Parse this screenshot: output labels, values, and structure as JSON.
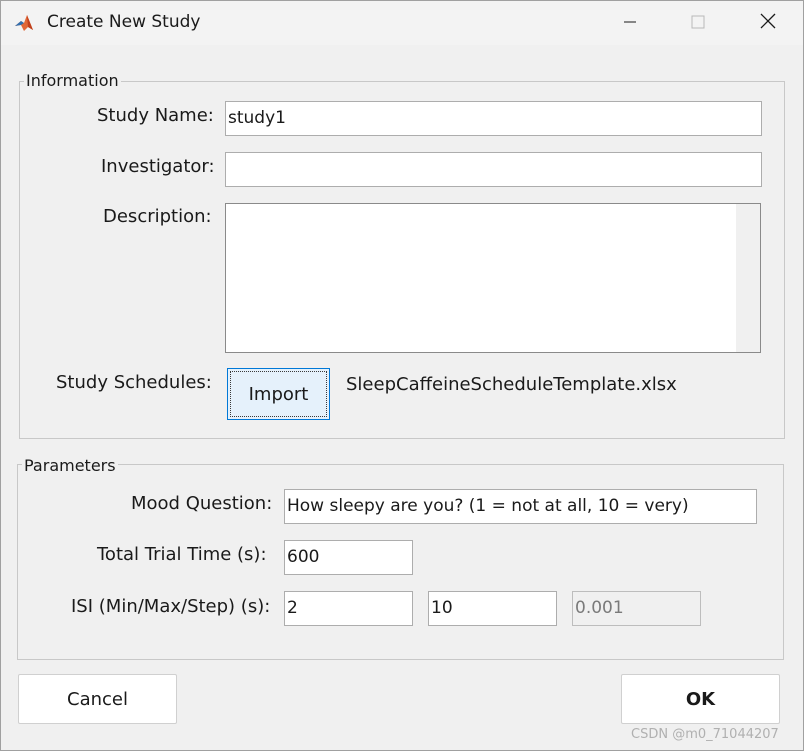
{
  "window": {
    "title": "Create New Study"
  },
  "information": {
    "legend": "Information",
    "study_name_label": "Study Name:",
    "study_name_value": "study1",
    "investigator_label": "Investigator:",
    "investigator_value": "",
    "description_label": "Description:",
    "description_value": "",
    "schedules_label": "Study Schedules:",
    "import_label": "Import",
    "schedule_file": "SleepCaffeineScheduleTemplate.xlsx"
  },
  "parameters": {
    "legend": "Parameters",
    "mood_label": "Mood Question:",
    "mood_value": "How sleepy are you? (1 = not at all, 10 = very)",
    "trial_label": "Total Trial Time (s):",
    "trial_value": "600",
    "isi_label": "ISI (Min/Max/Step) (s):",
    "isi_min": "2",
    "isi_max": "10",
    "isi_step": "0.001"
  },
  "footer": {
    "cancel_label": "Cancel",
    "ok_label": "OK"
  },
  "watermark": "CSDN @m0_71044207"
}
